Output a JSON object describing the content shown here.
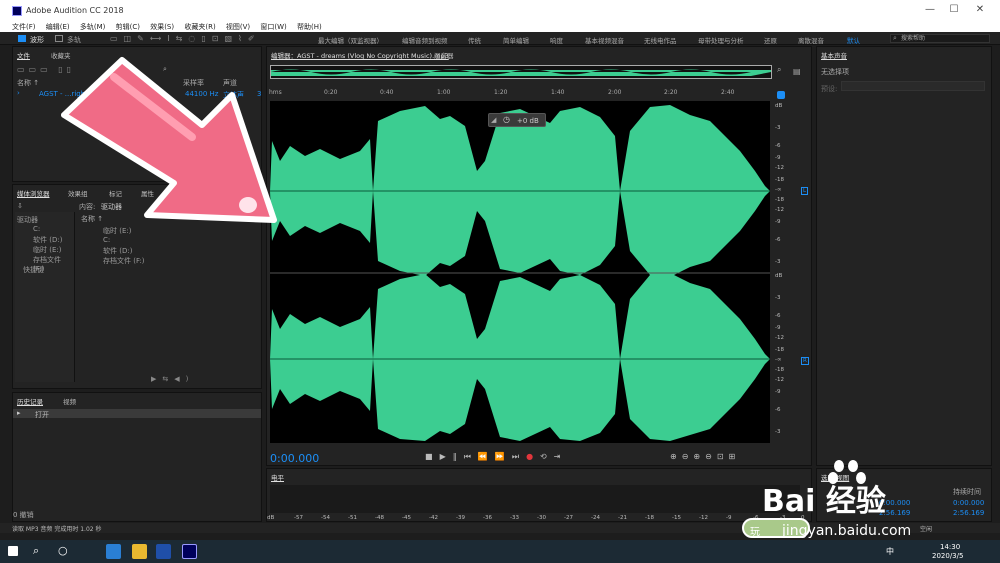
{
  "app": {
    "title": "Adobe Audition CC 2018",
    "window_buttons": [
      "—",
      "☐",
      "✕"
    ]
  },
  "menu": [
    "文件(F)",
    "编辑(E)",
    "多轨(M)",
    "剪辑(C)",
    "效果(S)",
    "收藏夹(R)",
    "视图(V)",
    "窗口(W)",
    "帮助(H)"
  ],
  "toolbar": {
    "wave_label": "波形",
    "multi_label": "多轨",
    "workspaces": [
      "最大编辑（双监视器）",
      "编辑音频到视频",
      "传统",
      "简单编辑",
      "响度",
      "基本视频混音",
      "无线电作品",
      "母带处理与分析",
      "还原",
      "离散混音"
    ],
    "default_label": "默认",
    "search_placeholder": "搜索帮助"
  },
  "files": {
    "tab_files": "文件",
    "tab_fav": "收藏夹",
    "col_name": "名称 ↑",
    "col_rate": "采样率",
    "col_ch": "声道",
    "row_name": "AGST - ...right Music",
    "row_rate": "44100 Hz",
    "row_ch": "立体声",
    "row_extra": "3"
  },
  "media": {
    "tab_media": "媒体浏览器",
    "tab_effects": "效果组",
    "tab_marks": "标记",
    "tab_props": "属性",
    "content_label": "内容:",
    "content_value": "驱动器",
    "col_name": "名称 ↑",
    "tree": [
      "驱动器",
      "C:",
      "软件 (D:)",
      "临时 (E:)",
      "存档文件 (F:)",
      "快捷键"
    ],
    "list": [
      "临时 (E:)",
      "C:",
      "软件 (D:)",
      "存档文件 (F:)"
    ]
  },
  "history": {
    "tab_history": "历史记录",
    "tab_video": "视频",
    "item": "打开",
    "undo_count": "0 撤销"
  },
  "editor": {
    "tab_label": "编辑器：AGST - dreams (Vlog No Copyright Music).mp3",
    "tab_mixer": "混音器",
    "hms": "hms",
    "ruler": [
      "0:20",
      "0:40",
      "1:00",
      "1:20",
      "1:40",
      "2:00",
      "2:20",
      "2:40"
    ],
    "gain": "+0 dB",
    "db_top": [
      "dB",
      "-3",
      "-6",
      "-9",
      "-12",
      "-18",
      "-∞",
      "-18",
      "-12",
      "-9",
      "-6",
      "-3"
    ],
    "channel_left": "L",
    "channel_right": "R",
    "timecode": "0:00.000"
  },
  "essential": {
    "title": "基本声音",
    "none_selected": "无选择项",
    "preset_label": "预设:"
  },
  "level": {
    "tab": "电平",
    "scale": [
      "dB",
      "-57",
      "-54",
      "-51",
      "-48",
      "-45",
      "-42",
      "-39",
      "-36",
      "-33",
      "-30",
      "-27",
      "-24",
      "-21",
      "-18",
      "-15",
      "-12",
      "-9",
      "-6",
      "-3",
      "0"
    ]
  },
  "selection": {
    "title": "选区/视图",
    "duration_label": "持续时间",
    "v1": "0:00.000",
    "v2": "0:00.000",
    "v3": "2:56.169",
    "v4": "2:56.169",
    "v5": "0:00.000",
    "v6": "2:56.169"
  },
  "status": {
    "left": "读取 MP3 音频 完成用时 1.02 秒",
    "right": "空闲"
  },
  "taskbar": {
    "time": "14:30",
    "date": "2020/3/5",
    "ime": "中"
  },
  "watermark": {
    "logo": "Bai 经验",
    "url": "jingyan.baidu.com",
    "stamp": "玩"
  }
}
